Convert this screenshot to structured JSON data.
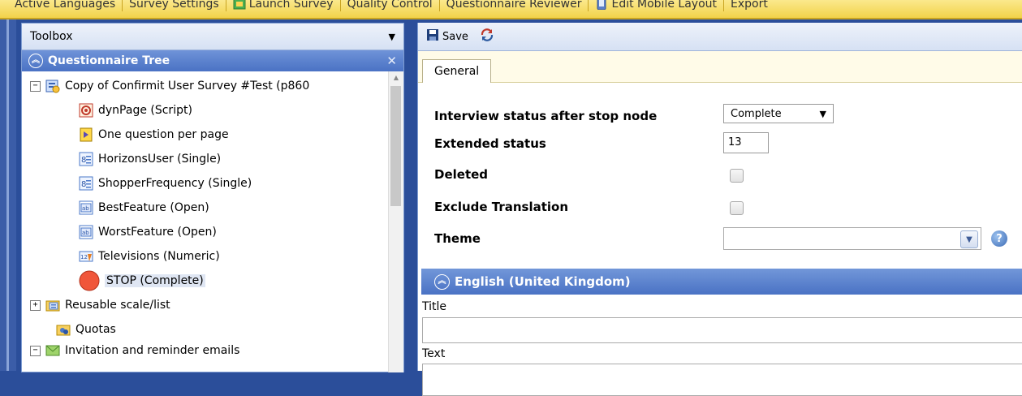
{
  "menu": {
    "items": [
      {
        "label": "Active Languages",
        "icon": ""
      },
      {
        "label": "Survey Settings",
        "icon": ""
      },
      {
        "label": "Launch Survey",
        "icon": "launch-icon"
      },
      {
        "label": "Quality Control",
        "icon": ""
      },
      {
        "label": "Questionnaire Reviewer",
        "icon": ""
      },
      {
        "label": "Edit Mobile Layout",
        "icon": "mobile-icon"
      },
      {
        "label": "Export",
        "icon": ""
      }
    ]
  },
  "toolbox": {
    "title": "Toolbox",
    "tree_header": "Questionnaire Tree",
    "tree": [
      {
        "label": "Copy of Confirmit User Survey #Test (p860",
        "icon": "survey-icon",
        "expander": "−"
      },
      {
        "label": "dynPage (Script)",
        "icon": "script-icon"
      },
      {
        "label": "One question per page",
        "icon": "page-icon"
      },
      {
        "label": "HorizonsUser (Single)",
        "icon": "single-icon"
      },
      {
        "label": "ShopperFrequency (Single)",
        "icon": "single-icon"
      },
      {
        "label": "BestFeature (Open)",
        "icon": "open-icon"
      },
      {
        "label": "WorstFeature (Open)",
        "icon": "open-icon"
      },
      {
        "label": "Televisions (Numeric)",
        "icon": "numeric-icon"
      },
      {
        "label": "STOP (Complete)",
        "icon": "stop-icon"
      },
      {
        "label": "Reusable scale/list",
        "icon": "folder-list-icon",
        "expander": "+"
      },
      {
        "label": "Quotas",
        "icon": "quotas-icon"
      },
      {
        "label": "Invitation and reminder emails",
        "icon": "email-icon",
        "expander": "−"
      }
    ]
  },
  "toolbar": {
    "save_label": "Save"
  },
  "tabs": {
    "general": "General"
  },
  "form": {
    "interview_status_label": "Interview status after stop node",
    "interview_status_value": "Complete",
    "extended_status_label": "Extended status",
    "extended_status_value": "13",
    "deleted_label": "Deleted",
    "exclude_translation_label": "Exclude Translation",
    "theme_label": "Theme",
    "theme_value": ""
  },
  "language_section": {
    "title": "English (United Kingdom)",
    "title_label": "Title",
    "text_label": "Text"
  }
}
